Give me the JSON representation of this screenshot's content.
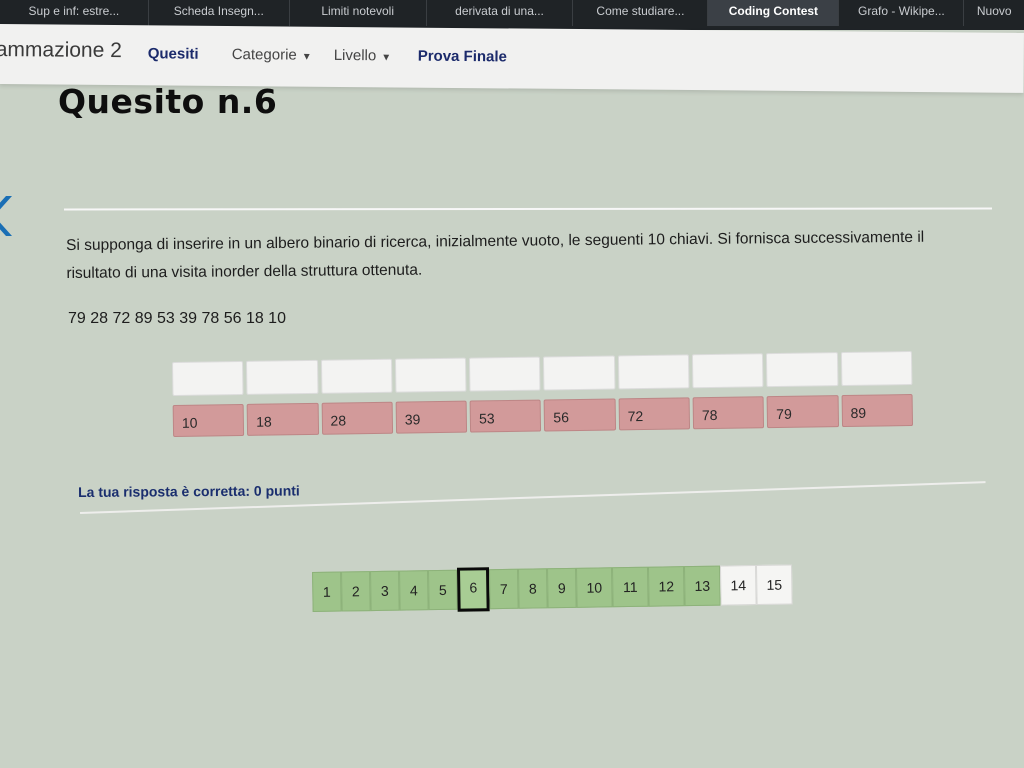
{
  "browser": {
    "tabs": [
      {
        "label": "Sup e inf: estre...",
        "active": false
      },
      {
        "label": "Scheda Insegn...",
        "active": false
      },
      {
        "label": "Limiti notevoli",
        "active": false
      },
      {
        "label": "derivata di una...",
        "active": false
      },
      {
        "label": "Come studiare...",
        "active": false
      },
      {
        "label": "Coding Contest",
        "active": true
      },
      {
        "label": "Grafo - Wikipe...",
        "active": false
      },
      {
        "label": "Nuovo",
        "active": false
      }
    ]
  },
  "navbar": {
    "brand": "ammazione 2",
    "items": {
      "quesiti": "Quesiti",
      "categorie": "Categorie",
      "livello": "Livello",
      "prova_finale": "Prova Finale"
    }
  },
  "page": {
    "title": "Quesito n.6",
    "question": "Si supponga di inserire in un albero binario di ricerca, inizialmente vuoto, le seguenti 10 chiavi. Si fornisca successivamente il risultato di una visita inorder della struttura ottenuta.",
    "keys": "79 28 72 89 53 39 78 56 18 10",
    "answer_chips": [
      "10",
      "18",
      "28",
      "39",
      "53",
      "56",
      "72",
      "78",
      "79",
      "89"
    ],
    "feedback": "La tua risposta è corretta: 0 punti"
  },
  "pager": {
    "current": "6",
    "pages": [
      {
        "label": "1",
        "state": "visited"
      },
      {
        "label": "2",
        "state": "visited"
      },
      {
        "label": "3",
        "state": "visited"
      },
      {
        "label": "4",
        "state": "visited"
      },
      {
        "label": "5",
        "state": "visited"
      },
      {
        "label": "6",
        "state": "current"
      },
      {
        "label": "7",
        "state": "visited"
      },
      {
        "label": "8",
        "state": "visited"
      },
      {
        "label": "9",
        "state": "visited"
      },
      {
        "label": "10",
        "state": "visited"
      },
      {
        "label": "11",
        "state": "visited"
      },
      {
        "label": "12",
        "state": "visited"
      },
      {
        "label": "13",
        "state": "visited"
      },
      {
        "label": "14",
        "state": "unvisited"
      },
      {
        "label": "15",
        "state": "unvisited"
      }
    ]
  },
  "colors": {
    "background": "#c9d2c6",
    "answer_chip": "#d29a9a",
    "page_visited": "#9ec48a",
    "link_blue": "#1b2a6b"
  }
}
